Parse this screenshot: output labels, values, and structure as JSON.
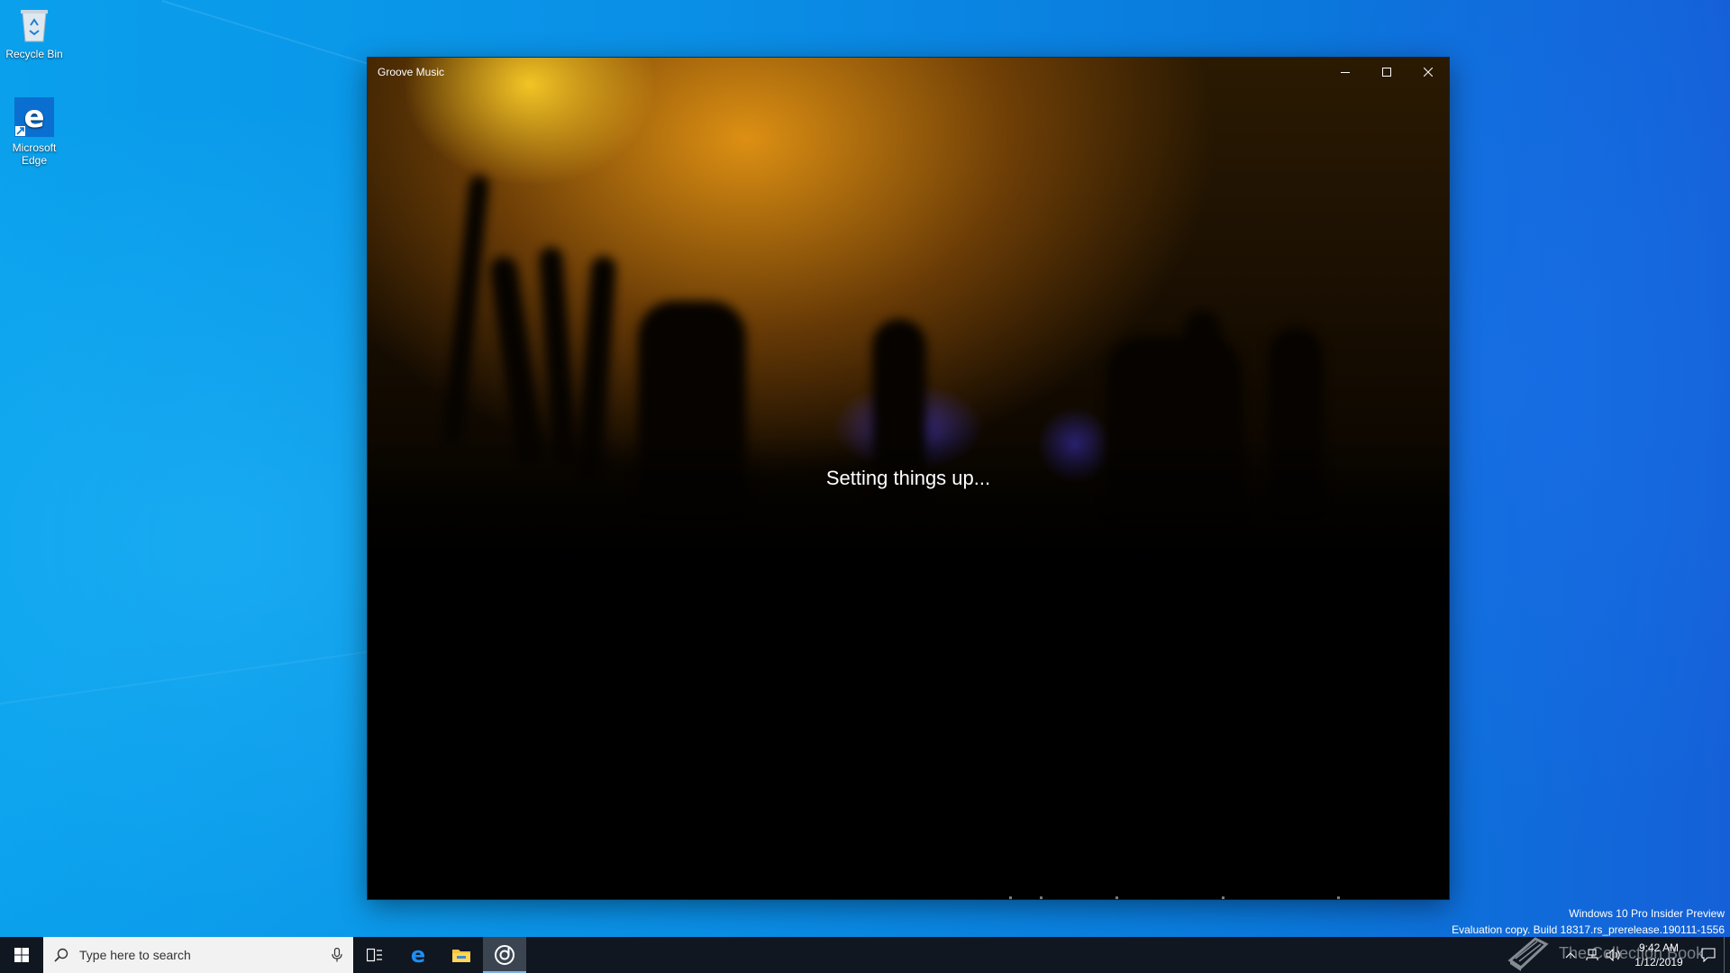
{
  "desktop": {
    "icons": [
      {
        "label": "Recycle Bin",
        "icon": "recycle-bin-icon"
      },
      {
        "label": "Microsoft Edge",
        "icon": "edge-icon"
      }
    ]
  },
  "window": {
    "title": "Groove Music",
    "status_text": "Setting things up...",
    "controls": {
      "minimize": "minimize-icon",
      "maximize": "maximize-icon",
      "close": "close-icon"
    }
  },
  "watermark": {
    "line1": "Windows 10 Pro Insider Preview",
    "line2": "Evaluation copy. Build 18317.rs_prerelease.190111-1556"
  },
  "taskbar": {
    "search_placeholder": "Type here to search",
    "apps": [
      "task-view-icon",
      "edge-icon",
      "file-explorer-icon",
      "groove-music-icon"
    ],
    "active_app": "groove-music-icon",
    "overlay_text": "The Collection Book",
    "clock": {
      "time": "9:42 AM",
      "date": "1/12/2019"
    }
  },
  "colors": {
    "accent": "#0078d7",
    "taskbar": "#101720",
    "search_bg": "#f2f2f2"
  }
}
